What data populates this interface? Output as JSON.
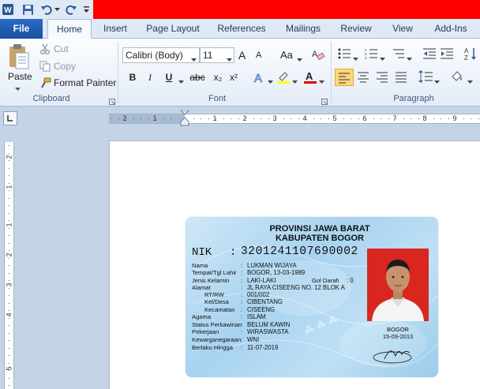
{
  "tabs": [
    "File",
    "Home",
    "Insert",
    "Page Layout",
    "References",
    "Mailings",
    "Review",
    "View",
    "Add-Ins"
  ],
  "clipboard": {
    "paste": "Paste",
    "cut": "Cut",
    "copy": "Copy",
    "format_painter": "Format Painter",
    "label": "Clipboard"
  },
  "font": {
    "name": "Calibri (Body)",
    "size": "11",
    "label": "Font",
    "grow": "A",
    "shrink": "A",
    "case": "Aa",
    "bold": "B",
    "italic": "I",
    "underline": "U",
    "strike": "abc",
    "sub": "x₂",
    "sup": "x²"
  },
  "paragraph": {
    "label": "Paragraph"
  },
  "ruler_h": [
    "2",
    "1",
    "1",
    "2",
    "3",
    "4",
    "5",
    "6",
    "7",
    "8",
    "9"
  ],
  "ruler_v": [
    "2",
    "1",
    "1",
    "2",
    "3",
    "4",
    "5"
  ],
  "ktp": {
    "province": "PROVINSI JAWA BARAT",
    "regency": "KABUPATEN BOGOR",
    "nik_label": "NIK",
    "nik_colon": ":",
    "nik": "3201241107690002",
    "fields": [
      {
        "label": "Nama",
        "value": "LUKMAN WIJAYA"
      },
      {
        "label": "Tempat/Tgl Lahir",
        "value": "BOGOR, 13-03-1989"
      },
      {
        "label": "Jenis Kelamin",
        "value": "LAKI-LAKI"
      },
      {
        "label": "Alamat",
        "value": "JL RAYA CISEENG NO. 12 BLOK A"
      },
      {
        "label": "RT/RW",
        "value": "001/002"
      },
      {
        "label": "Kel/Desa",
        "value": "CIBENTANG"
      },
      {
        "label": "Kecamatan",
        "value": "CISEENG"
      },
      {
        "label": "Agama",
        "value": "ISLAM"
      },
      {
        "label": "Status Perkawinan",
        "value": "BELUM KAWIN"
      },
      {
        "label": "Pekerjaan",
        "value": "WIRASWASTA"
      },
      {
        "label": "Kewarganegaraan",
        "value": "WNI"
      },
      {
        "label": "Berlaku Hingga",
        "value": "11-07-2019"
      }
    ],
    "gol_darah_label": "Gol Darah",
    "gol_darah_value": ": 0",
    "issue_place": "BOGOR",
    "issue_date": "15-09-2013"
  }
}
